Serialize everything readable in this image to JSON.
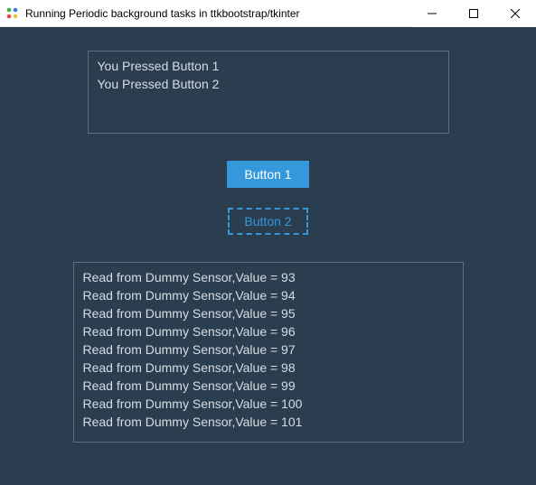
{
  "window": {
    "title": "Running Periodic background tasks in ttkbootstrap/tkinter"
  },
  "top_panel": {
    "lines": [
      "You Pressed Button 1",
      "You Pressed Button 2"
    ]
  },
  "buttons": {
    "button1": "Button 1",
    "button2": "Button 2"
  },
  "log_panel": {
    "lines": [
      "Read from Dummy Sensor,Value = 93",
      "Read from Dummy Sensor,Value = 94",
      "Read from Dummy Sensor,Value = 95",
      "Read from Dummy Sensor,Value = 96",
      "Read from Dummy Sensor,Value = 97",
      "Read from Dummy Sensor,Value = 98",
      "Read from Dummy Sensor,Value = 99",
      "Read from Dummy Sensor,Value = 100",
      "Read from Dummy Sensor,Value = 101"
    ]
  },
  "colors": {
    "client_bg": "#2b3e50",
    "panel_border": "#5a6f82",
    "panel_text": "#d7dde3",
    "primary": "#3498db"
  }
}
